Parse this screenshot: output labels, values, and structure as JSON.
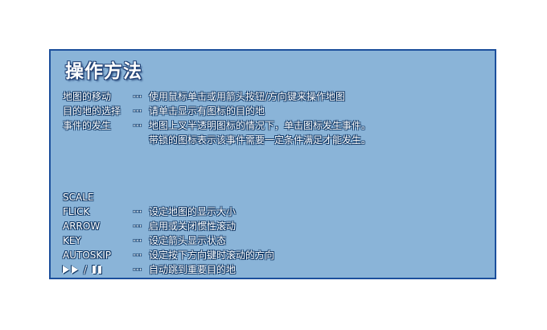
{
  "panel": {
    "title": "操作方法",
    "bg_color": "#8ab4d8",
    "border_color": "#1c4f9c"
  },
  "separator": "···",
  "top_items": [
    {
      "label": "地图的移动",
      "desc": "使用鼠标单击或用箭头按钮/方向键来操作地图"
    },
    {
      "label": "目的地的选择",
      "desc": "请单击显示有图标的目的地"
    },
    {
      "label": "事件的发生",
      "desc": "地图上叉半透明图标的情况下，单击图标发生事件。"
    },
    {
      "label": "",
      "desc": "带锁的图标表示该事件需要一定条件满足才能发生。"
    }
  ],
  "scale_label": "SCALE",
  "bottom_items": [
    {
      "label": "FLICK",
      "desc": "设定地图的显示大小"
    },
    {
      "label": "ARROW",
      "desc": "启用或关闭惯性滚动"
    },
    {
      "label": "KEY",
      "desc": "设定箭头显示状态"
    },
    {
      "label": "AUTOSKIP",
      "desc": "设定按下方向键时滚动的方向"
    }
  ],
  "play_pause": {
    "icons": [
      "play-icon",
      "play-icon",
      "pause-icon"
    ],
    "slash": "/",
    "desc": "自动跳到重要目的地"
  }
}
